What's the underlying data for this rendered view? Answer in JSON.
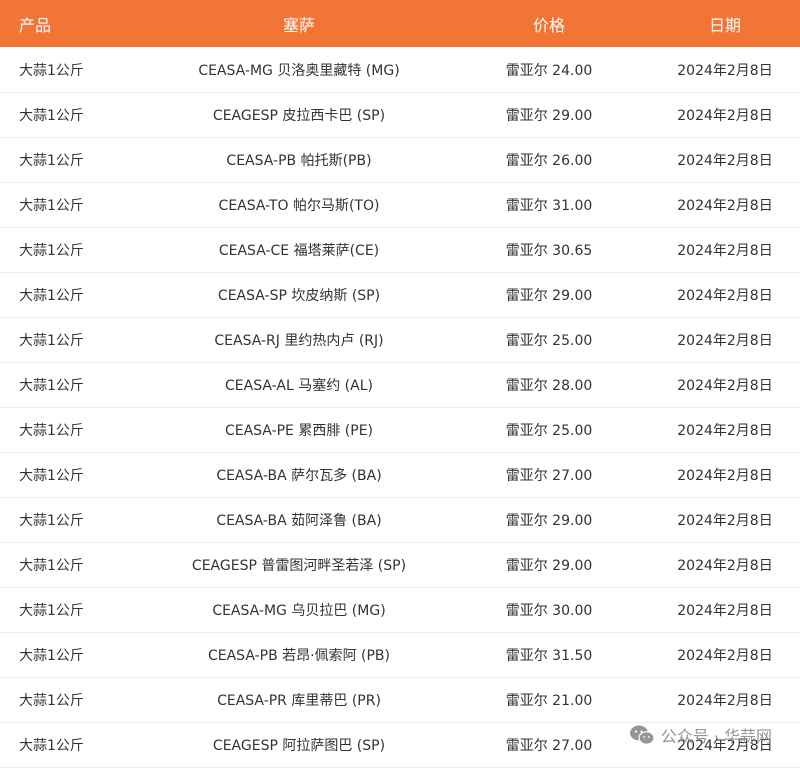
{
  "table": {
    "columns": [
      "产品",
      "塞萨",
      "价格",
      "日期"
    ],
    "rows": [
      [
        "大蒜1公斤",
        "CEASA-MG 贝洛奥里藏特 (MG)",
        "雷亚尔 24.00",
        "2024年2月8日"
      ],
      [
        "大蒜1公斤",
        "CEAGESP 皮拉西卡巴 (SP)",
        "雷亚尔 29.00",
        "2024年2月8日"
      ],
      [
        "大蒜1公斤",
        "CEASA-PB 帕托斯(PB)",
        "雷亚尔 26.00",
        "2024年2月8日"
      ],
      [
        "大蒜1公斤",
        "CEASA-TO 帕尔马斯(TO)",
        "雷亚尔 31.00",
        "2024年2月8日"
      ],
      [
        "大蒜1公斤",
        "CEASA-CE 福塔莱萨(CE)",
        "雷亚尔 30.65",
        "2024年2月8日"
      ],
      [
        "大蒜1公斤",
        "CEASA-SP 坎皮纳斯 (SP)",
        "雷亚尔 29.00",
        "2024年2月8日"
      ],
      [
        "大蒜1公斤",
        "CEASA-RJ 里约热内卢 (RJ)",
        "雷亚尔 25.00",
        "2024年2月8日"
      ],
      [
        "大蒜1公斤",
        "CEASA-AL 马塞约 (AL)",
        "雷亚尔 28.00",
        "2024年2月8日"
      ],
      [
        "大蒜1公斤",
        "CEASA-PE 累西腓 (PE)",
        "雷亚尔 25.00",
        "2024年2月8日"
      ],
      [
        "大蒜1公斤",
        "CEASA-BA 萨尔瓦多 (BA)",
        "雷亚尔 27.00",
        "2024年2月8日"
      ],
      [
        "大蒜1公斤",
        "CEASA-BA 茹阿泽鲁 (BA)",
        "雷亚尔 29.00",
        "2024年2月8日"
      ],
      [
        "大蒜1公斤",
        "CEAGESP 普雷图河畔圣若泽 (SP)",
        "雷亚尔 29.00",
        "2024年2月8日"
      ],
      [
        "大蒜1公斤",
        "CEASA-MG 乌贝拉巴 (MG)",
        "雷亚尔 30.00",
        "2024年2月8日"
      ],
      [
        "大蒜1公斤",
        "CEASA-PB 若昂·佩索阿 (PB)",
        "雷亚尔 31.50",
        "2024年2月8日"
      ],
      [
        "大蒜1公斤",
        "CEASA-PR 库里蒂巴 (PR)",
        "雷亚尔 21.00",
        "2024年2月8日"
      ],
      [
        "大蒜1公斤",
        "CEAGESP 阿拉萨图巴 (SP)",
        "雷亚尔 27.00",
        "2024年2月8日"
      ]
    ]
  },
  "watermark": {
    "text": "公众号 · 华蒜网",
    "icon": "wechat-icon"
  },
  "colors": {
    "header_bg": "#f27536",
    "header_text": "#ffffff",
    "row_divider": "#ececec",
    "cell_text": "#333333"
  }
}
